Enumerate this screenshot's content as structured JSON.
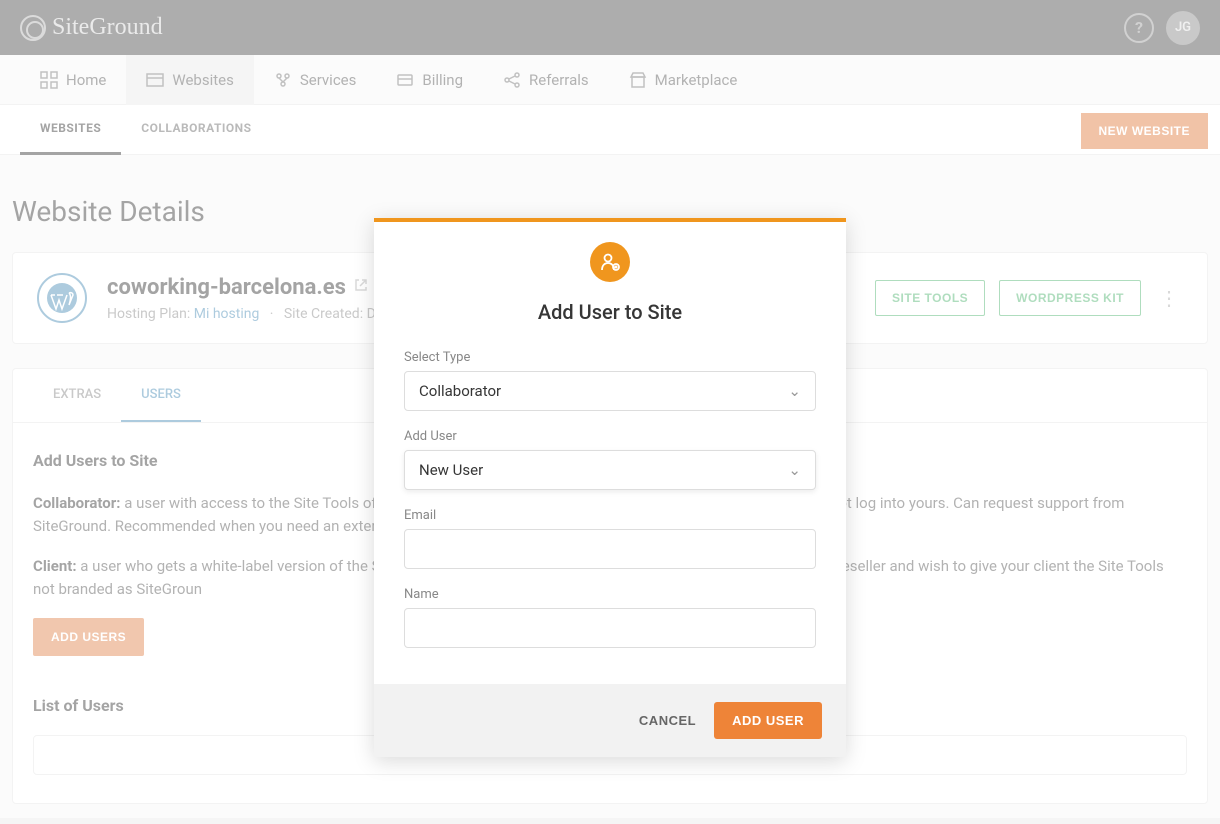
{
  "header": {
    "brand": "SiteGround",
    "help_icon": "help-icon",
    "avatar_initials": "JG"
  },
  "nav": {
    "items": [
      {
        "icon": "grid-icon",
        "label": "Home"
      },
      {
        "icon": "websites-icon",
        "label": "Websites"
      },
      {
        "icon": "services-icon",
        "label": "Services"
      },
      {
        "icon": "billing-icon",
        "label": "Billing"
      },
      {
        "icon": "referrals-icon",
        "label": "Referrals"
      },
      {
        "icon": "marketplace-icon",
        "label": "Marketplace"
      }
    ],
    "active_index": 1
  },
  "subnav": {
    "tabs": [
      {
        "label": "WEBSITES"
      },
      {
        "label": "COLLABORATIONS"
      }
    ],
    "active_index": 0,
    "new_button": "NEW WEBSITE"
  },
  "page_title": "Website Details",
  "site": {
    "icon": "wordpress-icon",
    "domain": "coworking-barcelona.es",
    "hosting_plan_label": "Hosting Plan:",
    "hosting_plan_value": "Mi hosting",
    "separator": "·",
    "created_label": "Site Created: D",
    "site_tools_btn": "SITE TOOLS",
    "wordpress_kit_btn": "WORDPRESS KIT",
    "more_icon": "more-vertical-icon"
  },
  "detail_tabs": {
    "items": [
      {
        "label": "EXTRAS"
      },
      {
        "label": "USERS"
      }
    ],
    "active_index": 1
  },
  "users_section": {
    "heading": "Add Users to Site",
    "collaborator_label": "Collaborator:",
    "collaborator_text": " a user with access to the Site Tools of your website that manages their own SiteGround account and does not log into yours. Can request support from SiteGround. Recommended when you need an external developer to collaborate on your site.",
    "client_label": "Client:",
    "client_text": " a user who gets a white-label version of the Site Tools and cannot contact SiteGround. Recommended if you are a reseller and wish to give your client the Site Tools not branded as SiteGroun",
    "add_users_btn": "ADD USERS",
    "list_title": "List of Users"
  },
  "modal": {
    "icon": "user-add-icon",
    "title": "Add User to Site",
    "select_type_label": "Select Type",
    "select_type_value": "Collaborator",
    "add_user_label": "Add User",
    "add_user_value": "New User",
    "email_label": "Email",
    "email_value": "",
    "name_label": "Name",
    "name_value": "",
    "cancel": "CANCEL",
    "submit": "ADD USER"
  }
}
